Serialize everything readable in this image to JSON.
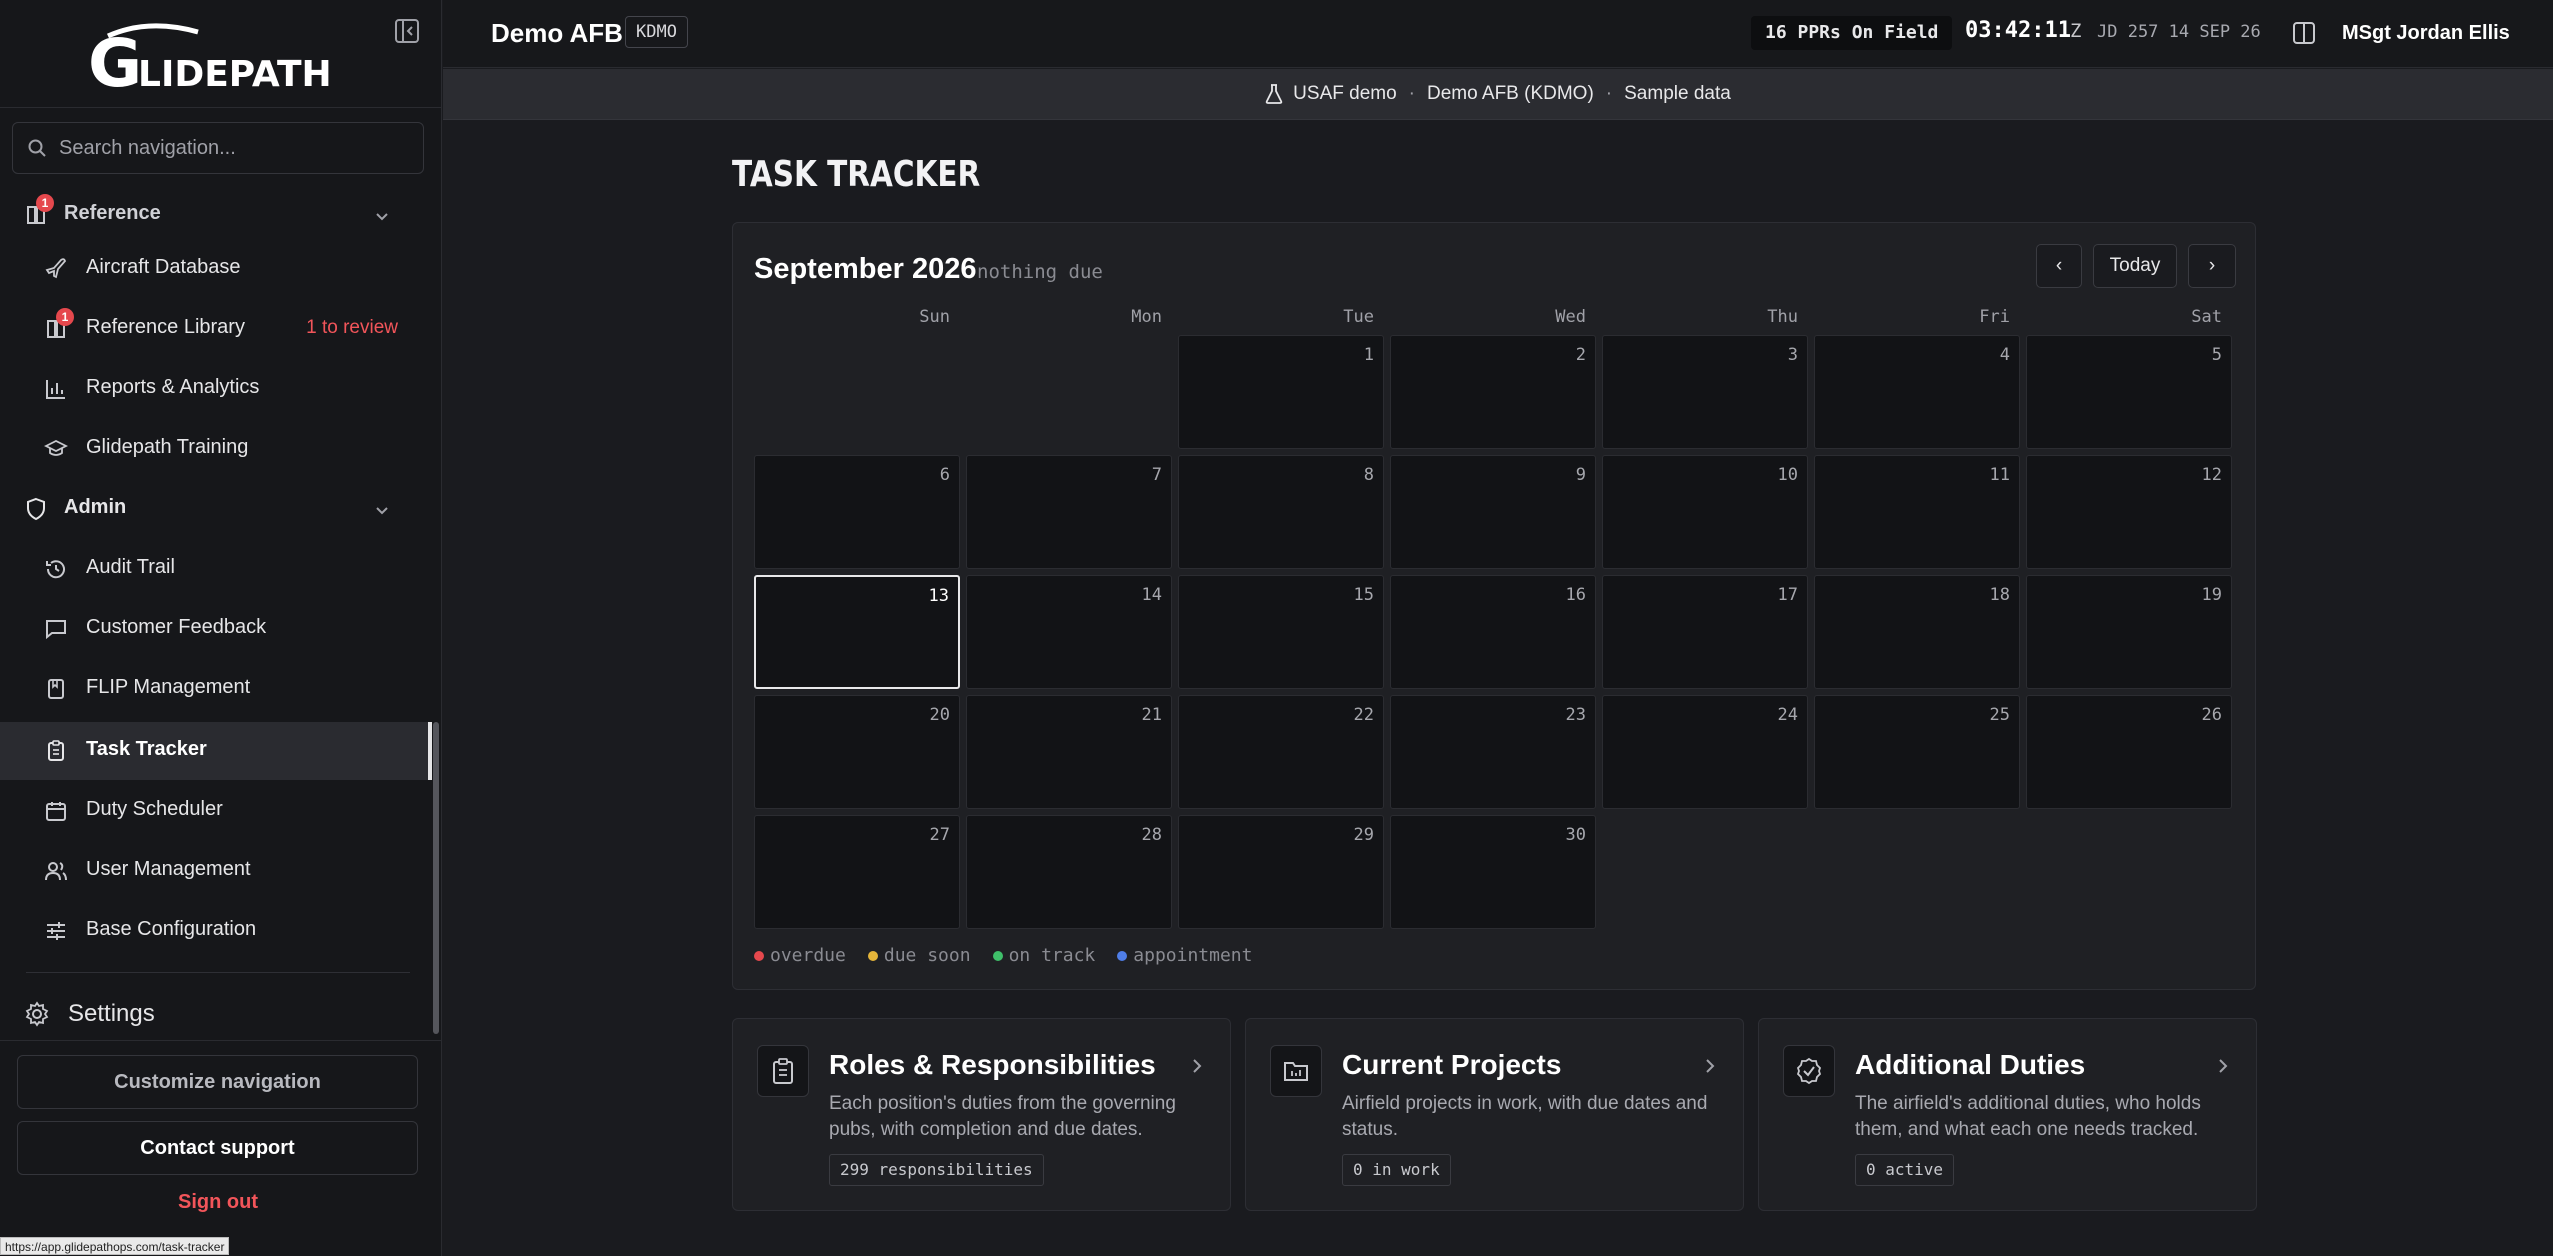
{
  "brand": {
    "logo_text": "GLIDEPATH"
  },
  "search": {
    "placeholder": "Search navigation..."
  },
  "sidebar": {
    "reference_section": {
      "label": "Reference",
      "badge": "1"
    },
    "items": [
      {
        "label": "Aircraft Database"
      },
      {
        "label": "Reference Library",
        "badge": "1",
        "note": "1 to review"
      },
      {
        "label": "Reports & Analytics"
      },
      {
        "label": "Glidepath Training"
      }
    ],
    "admin_section": {
      "label": "Admin"
    },
    "admin_items": [
      {
        "label": "Audit Trail"
      },
      {
        "label": "Customer Feedback"
      },
      {
        "label": "FLIP Management"
      },
      {
        "label": "Task Tracker",
        "active": true
      },
      {
        "label": "Duty Scheduler"
      },
      {
        "label": "User Management"
      },
      {
        "label": "Base Configuration"
      }
    ],
    "settings_label": "Settings",
    "customize_label": "Customize navigation",
    "contact_label": "Contact support",
    "signout_label": "Sign out"
  },
  "status_url": "https://app.glidepathops.com/task-tracker",
  "topbar": {
    "base_name": "Demo AFB",
    "base_code": "KDMO",
    "pprs": "16 PPRs On Field",
    "clock": "03:42:11",
    "zone": "Z",
    "julian": "JD 257  14 SEP 26",
    "user": "MSgt Jordan Ellis"
  },
  "banner": {
    "org": "USAF demo",
    "base": "Demo AFB (KDMO)",
    "mode": "Sample data"
  },
  "page": {
    "title": "TASK TRACKER"
  },
  "calendar": {
    "month": "September 2026",
    "due_status": "nothing due",
    "prev": "‹",
    "today": "Today",
    "next": "›",
    "weekdays": [
      "Sun",
      "Mon",
      "Tue",
      "Wed",
      "Thu",
      "Fri",
      "Sat"
    ],
    "first_weekday_index": 2,
    "days_in_month": 30,
    "today_day": 13,
    "legend": [
      {
        "label": "overdue",
        "color": "#e5484d"
      },
      {
        "label": "due soon",
        "color": "#e5b53a"
      },
      {
        "label": "on track",
        "color": "#3fbf6a"
      },
      {
        "label": "appointment",
        "color": "#4f7ee8"
      }
    ]
  },
  "cards": [
    {
      "title": "Roles & Responsibilities",
      "desc": "Each position's duties from the governing pubs, with completion and due dates.",
      "pill": "299 responsibilities",
      "icon": "clipboard-icon"
    },
    {
      "title": "Current Projects",
      "desc": "Airfield projects in work, with due dates and status.",
      "pill": "0 in work",
      "icon": "project-folder-icon"
    },
    {
      "title": "Additional Duties",
      "desc": "The airfield's additional duties, who holds them, and what each one needs tracked.",
      "pill": "0 active",
      "icon": "badge-check-icon"
    }
  ]
}
